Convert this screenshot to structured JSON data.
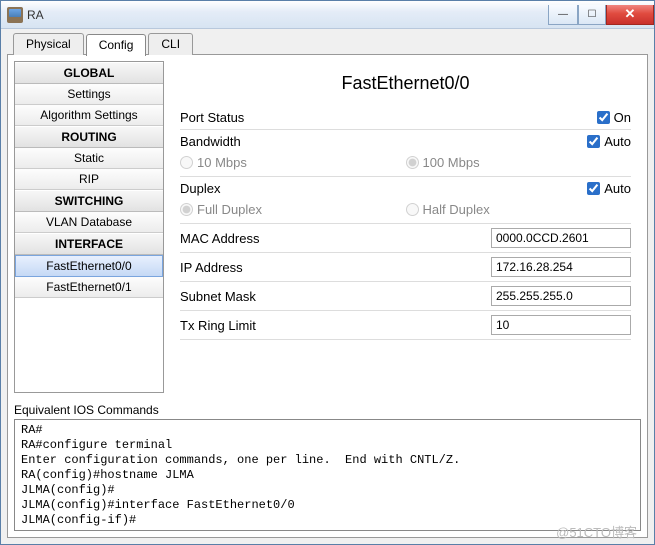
{
  "window": {
    "title": "RA"
  },
  "tabs": {
    "items": [
      "Physical",
      "Config",
      "CLI"
    ],
    "active": "Config"
  },
  "sidebar": {
    "groups": [
      {
        "header": "GLOBAL",
        "items": [
          "Settings",
          "Algorithm Settings"
        ]
      },
      {
        "header": "ROUTING",
        "items": [
          "Static",
          "RIP"
        ]
      },
      {
        "header": "SWITCHING",
        "items": [
          "VLAN Database"
        ]
      },
      {
        "header": "INTERFACE",
        "items": [
          "FastEthernet0/0",
          "FastEthernet0/1"
        ]
      }
    ],
    "selected": "FastEthernet0/0"
  },
  "main": {
    "title": "FastEthernet0/0",
    "port_status": {
      "label": "Port Status",
      "on": true,
      "on_label": "On"
    },
    "bandwidth": {
      "label": "Bandwidth",
      "auto": true,
      "auto_label": "Auto",
      "options": [
        "10 Mbps",
        "100 Mbps"
      ],
      "selected": "100 Mbps"
    },
    "duplex": {
      "label": "Duplex",
      "auto": true,
      "auto_label": "Auto",
      "options": [
        "Full Duplex",
        "Half Duplex"
      ],
      "selected": "Full Duplex"
    },
    "mac": {
      "label": "MAC Address",
      "value": "0000.0CCD.2601"
    },
    "ip": {
      "label": "IP Address",
      "value": "172.16.28.254"
    },
    "mask": {
      "label": "Subnet Mask",
      "value": "255.255.255.0"
    },
    "txring": {
      "label": "Tx Ring Limit",
      "value": "10"
    }
  },
  "console": {
    "label": "Equivalent IOS Commands",
    "lines": [
      "RA#",
      "RA#configure terminal",
      "Enter configuration commands, one per line.  End with CNTL/Z.",
      "RA(config)#hostname JLMA",
      "JLMA(config)#",
      "JLMA(config)#interface FastEthernet0/0",
      "JLMA(config-if)#"
    ]
  },
  "watermark": "@51CTO博客"
}
